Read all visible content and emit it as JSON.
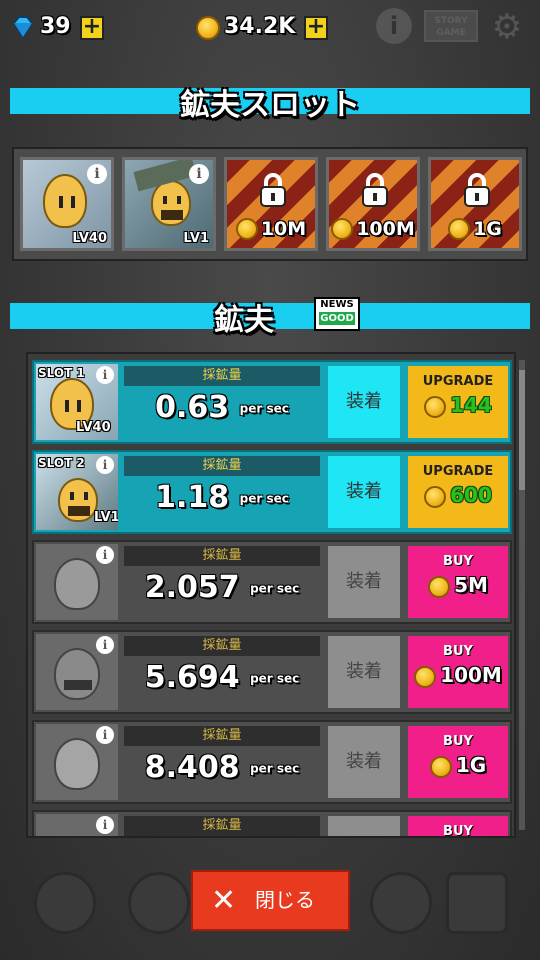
{
  "topbar": {
    "gems": "39",
    "coins": "34.2K",
    "plus": "+",
    "info": "i",
    "story_line1": "STORY",
    "story_line2": "GAME",
    "gear": "⚙"
  },
  "slots_section": {
    "title": "鉱夫スロット",
    "slots": [
      {
        "type": "character",
        "level": "LV40",
        "info": "i"
      },
      {
        "type": "character",
        "level": "LV1",
        "info": "i"
      },
      {
        "type": "locked",
        "price": "10M"
      },
      {
        "type": "locked",
        "price": "100M"
      },
      {
        "type": "locked",
        "price": "1G"
      }
    ]
  },
  "miners_section": {
    "title": "鉱夫",
    "badge_top": "NEWS",
    "badge_bottom": "GOOD",
    "rate_label": "採鉱量",
    "rate_unit": "per sec",
    "equip_label": "装着",
    "rows": [
      {
        "slot": "SLOT 1",
        "level": "LV40",
        "rate": "0.63",
        "action": "UPGRADE",
        "price": "144",
        "state": "owned"
      },
      {
        "slot": "SLOT 2",
        "level": "LV1",
        "rate": "1.18",
        "action": "UPGRADE",
        "price": "600",
        "state": "owned"
      },
      {
        "slot": "",
        "level": "",
        "rate": "2.057",
        "action": "BUY",
        "price": "5M",
        "state": "locked"
      },
      {
        "slot": "",
        "level": "",
        "rate": "5.694",
        "action": "BUY",
        "price": "100M",
        "state": "locked"
      },
      {
        "slot": "",
        "level": "",
        "rate": "8.408",
        "action": "BUY",
        "price": "1G",
        "state": "locked"
      },
      {
        "slot": "",
        "level": "",
        "rate": "",
        "action": "BUY",
        "price": "",
        "state": "locked"
      }
    ]
  },
  "close_button": {
    "label": "閉じる",
    "icon": "✕"
  },
  "colors": {
    "banner": "#19cef0",
    "owned_row": "#16a3b3",
    "upgrade": "#f2b919",
    "buy": "#f01f8a",
    "close": "#e83a1f"
  }
}
